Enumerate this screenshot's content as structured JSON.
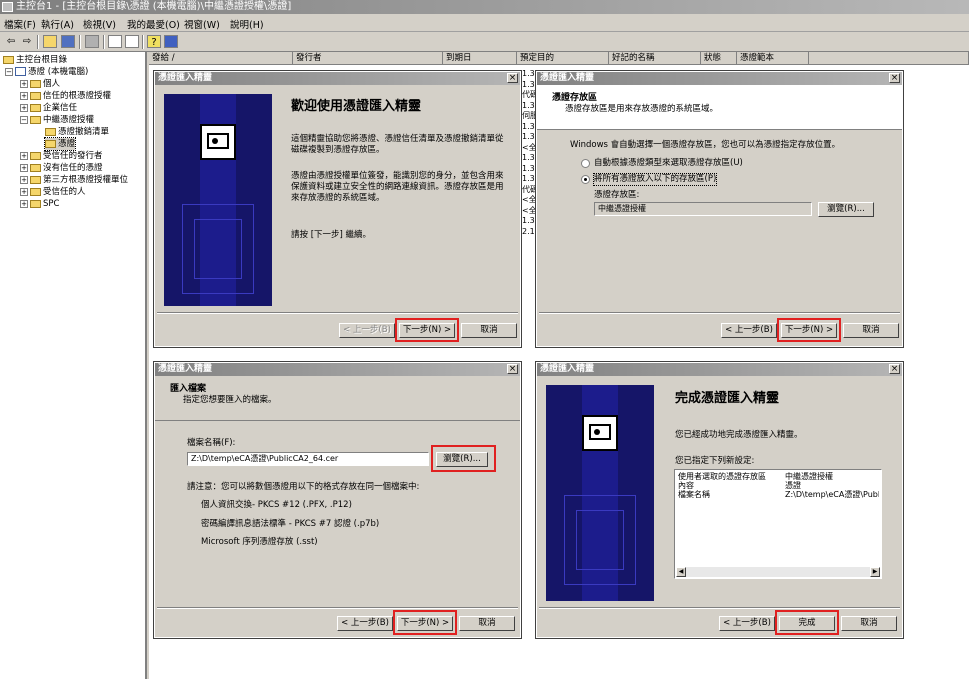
{
  "window": {
    "title": "主控台1 - [主控台根目錄\\憑證 (本機電腦)\\中繼憑證授權\\憑證]"
  },
  "menu": [
    "檔案(F)",
    "執行(A)",
    "檢視(V)",
    "我的最愛(O)",
    "視窗(W)",
    "說明(H)"
  ],
  "toolbar_icons": [
    "back-arrow-icon",
    "forward-arrow-icon",
    "up-folder-icon",
    "show-tree-icon",
    "delete-icon",
    "properties-icon",
    "export-list-icon",
    "help-icon",
    "console-icon"
  ],
  "tree": {
    "root": "主控台根目錄",
    "computer": "憑證 (本機電腦)",
    "items": [
      "個人",
      "信任的根憑證授權",
      "企業信任",
      "中繼憑證授權"
    ],
    "children": [
      "憑證撤銷清單",
      "憑證"
    ],
    "items2": [
      "受信任的發行者",
      "沒有信任的憑證",
      "第三方根憑證授權單位",
      "受信任的人",
      "SPC"
    ]
  },
  "columns": [
    "發給 /",
    "發行者",
    "到期日",
    "預定目的",
    "好記的名稱",
    "狀態",
    "憑證範本"
  ],
  "col_fragments": [
    "1.3",
    "1.3",
    "代碼",
    "1.3",
    "伺服",
    "1.3",
    "1.3",
    "<全",
    "1.3",
    "1.3",
    "1.3",
    "代碼",
    "<全",
    "<全",
    "1.3",
    "2.16"
  ],
  "dialog_title": "憑證匯入精靈",
  "d1": {
    "heading": "歡迎使用憑證匯入精靈",
    "para1": "這個精靈協助您將憑證、憑證信任清單及憑證撤銷清單從磁碟複製到憑證存放區。",
    "para2": "憑證由憑證授權單位簽發，能識別您的身分，並包含用來保護資料或建立安全性的網路連線資訊。憑證存放區是用來存放憑證的系統區域。",
    "para3": "請按 [下一步] 繼續。",
    "back": "< 上一步(B)",
    "next": "下一步(N) >",
    "cancel": "取消"
  },
  "d2": {
    "h1": "憑證存放區",
    "h2": "憑證存放區是用來存放憑證的系統區域。",
    "intro": "Windows 會自動選擇一個憑證存放區，您也可以為憑證指定存放位置。",
    "opt1": "自動根據憑證類型來選取憑證存放區(U)",
    "opt2": "將所有憑證放入以下的存放區(P)",
    "store_label": "憑證存放區:",
    "store_value": "中繼憑證授權",
    "browse": "瀏覽(R)...",
    "back": "< 上一步(B)",
    "next": "下一步(N) >",
    "cancel": "取消"
  },
  "d3": {
    "h1": "匯入檔案",
    "h2": "指定您想要匯入的檔案。",
    "file_label": "檔案名稱(F):",
    "file_value": "Z:\\D\\temp\\eCA憑證\\PublicCA2_64.cer",
    "browse": "瀏覽(R)...",
    "note": "請注意：您可以將數個憑證用以下的格式存放在同一個檔案中:",
    "f1": "個人資訊交換- PKCS #12 (.PFX, .P12)",
    "f2": "密碼編譯訊息語法標準 - PKCS #7 認證 (.p7b)",
    "f3": "Microsoft 序列憑證存放 (.sst)",
    "back": "< 上一步(B)",
    "next": "下一步(N) >",
    "cancel": "取消"
  },
  "d4": {
    "heading": "完成憑證匯入精靈",
    "para1": "您已經成功地完成憑證匯入精靈。",
    "para2": "您已指定下列新設定:",
    "rows": [
      [
        "使用者選取的憑證存放區",
        "中繼憑證授權"
      ],
      [
        "內容",
        "憑證"
      ],
      [
        "檔案名稱",
        "Z:\\D\\temp\\eCA憑證\\PublicC"
      ]
    ],
    "back": "< 上一步(B)",
    "finish": "完成",
    "cancel": "取消"
  },
  "colors": {
    "wizard_blue": "#151568",
    "highlight": "#e02020",
    "title_gray": "#828282"
  }
}
